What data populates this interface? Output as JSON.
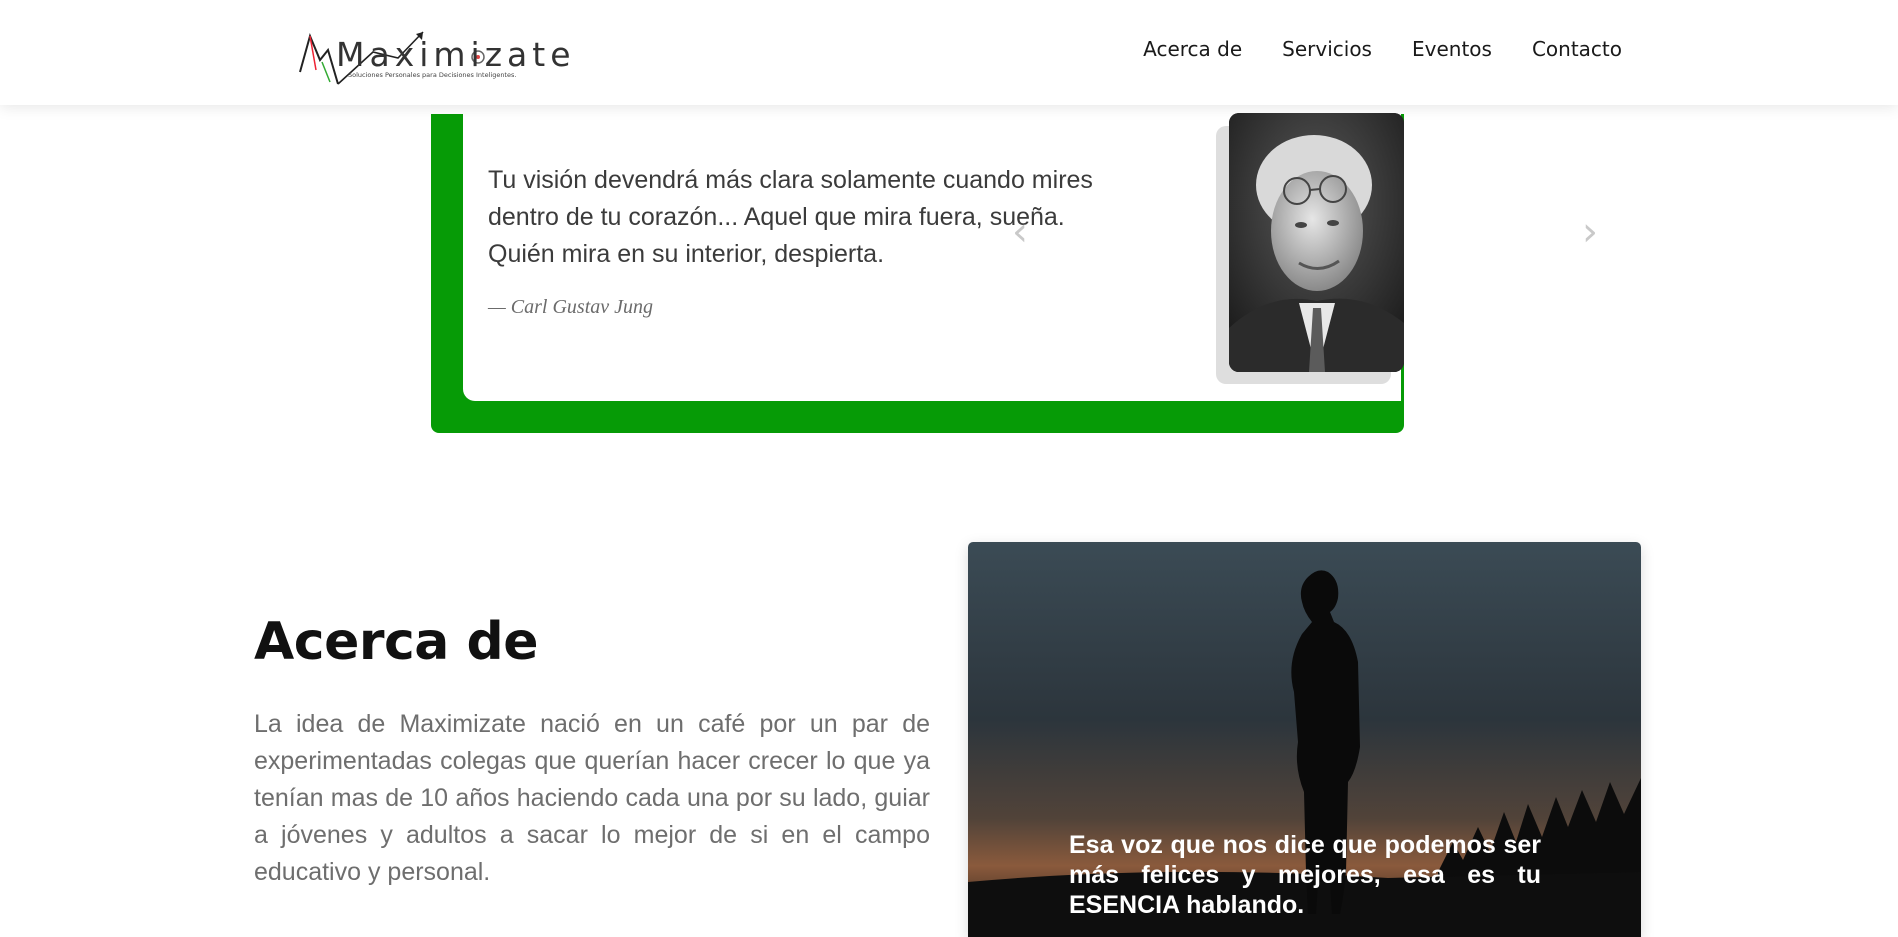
{
  "header": {
    "logo": {
      "wordmark": "Maximizate",
      "tagline": "Soluciones Personales para Decisiones Inteligentes."
    },
    "nav": [
      {
        "label": "Acerca de"
      },
      {
        "label": "Servicios"
      },
      {
        "label": "Eventos"
      },
      {
        "label": "Contacto"
      }
    ]
  },
  "quote": {
    "text": "Tu visión devendrá más clara solamente cuando mires dentro de tu corazón... Aquel que mira fuera, sueña. Quién mira en su interior, despierta.",
    "author": "— Carl Gustav Jung",
    "accent_color": "#069b06"
  },
  "about": {
    "title": "Acerca de",
    "body": "La idea de Maximizate nació en un café por un par de experimentadas colegas que querían hacer crecer lo que ya tenían mas de 10 años haciendo cada una por su lado, guiar a jóvenes y adultos a sacar lo mejor de si en el campo educativo y personal."
  },
  "carousel": {
    "prev_icon": "chevron-left-icon",
    "next_icon": "chevron-right-icon",
    "caption": "Esa voz que nos dice que podemos ser más felices y mejores, esa es tu ESENCIA hablando."
  }
}
